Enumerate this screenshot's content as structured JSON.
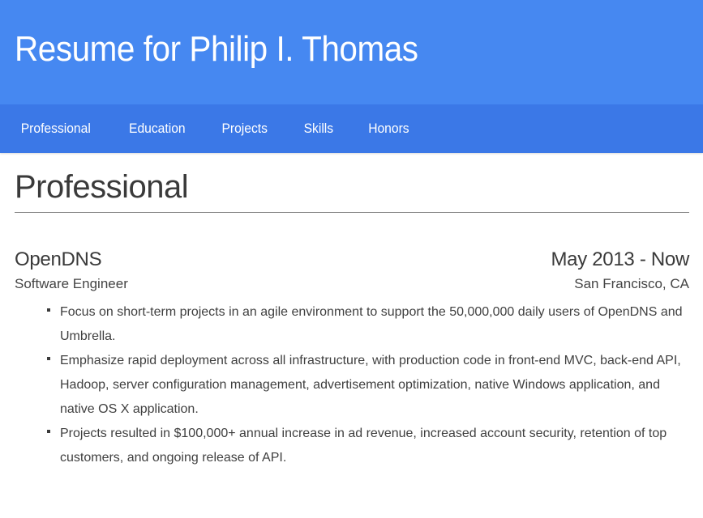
{
  "header": {
    "title": "Resume for Philip I. Thomas"
  },
  "nav": {
    "items": [
      {
        "label": "Professional"
      },
      {
        "label": "Education"
      },
      {
        "label": "Projects"
      },
      {
        "label": "Skills"
      },
      {
        "label": "Honors"
      }
    ]
  },
  "section": {
    "title": "Professional",
    "jobs": [
      {
        "company": "OpenDNS",
        "dates": "May 2013 - Now",
        "role": "Software Engineer",
        "location": "San Francisco, CA",
        "bullets": [
          "Focus on short-term projects in an agile environment to support the 50,000,000 daily users of OpenDNS and Umbrella.",
          "Emphasize rapid deployment across all infrastructure, with production code in front-end MVC, back-end API, Hadoop, server configuration management, advertisement optimization, native Windows application, and native OS X application.",
          "Projects resulted in $100,000+ annual increase in ad revenue, increased account security, retention of top customers, and ongoing release of API."
        ]
      }
    ]
  },
  "colors": {
    "header_bg": "#4688f1",
    "nav_bg": "#3b78e7",
    "text": "#3a3a3a"
  }
}
